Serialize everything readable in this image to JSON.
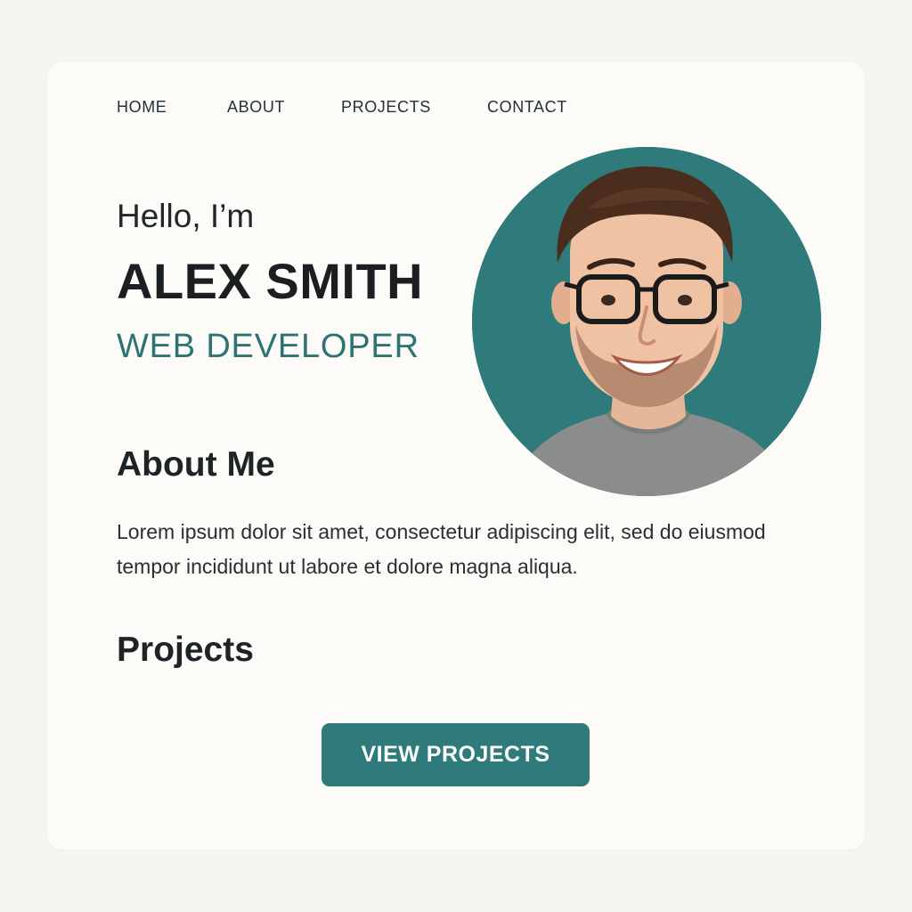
{
  "nav": {
    "items": [
      {
        "label": "HOME"
      },
      {
        "label": "ABOUT"
      },
      {
        "label": "PROJECTS"
      },
      {
        "label": "CONTACT"
      }
    ]
  },
  "hero": {
    "greeting": "Hello, I’m",
    "name": "ALEX SMITH",
    "role": "WEB DEVELOPER",
    "avatar_bg": "#2f7a7a"
  },
  "about": {
    "title": "About Me",
    "text": "Lorem ipsum dolor sit amet, consectetur adipiscing elit, sed do eiusmod tempor incididunt ut labore et dolore magna aliqua."
  },
  "projects": {
    "title": "Projects",
    "button_label": "VIEW PROJECTS"
  },
  "colors": {
    "accent": "#2f7a7a",
    "background": "#f6f5f1",
    "card": "#fcfbf8",
    "text": "#1d2326"
  }
}
